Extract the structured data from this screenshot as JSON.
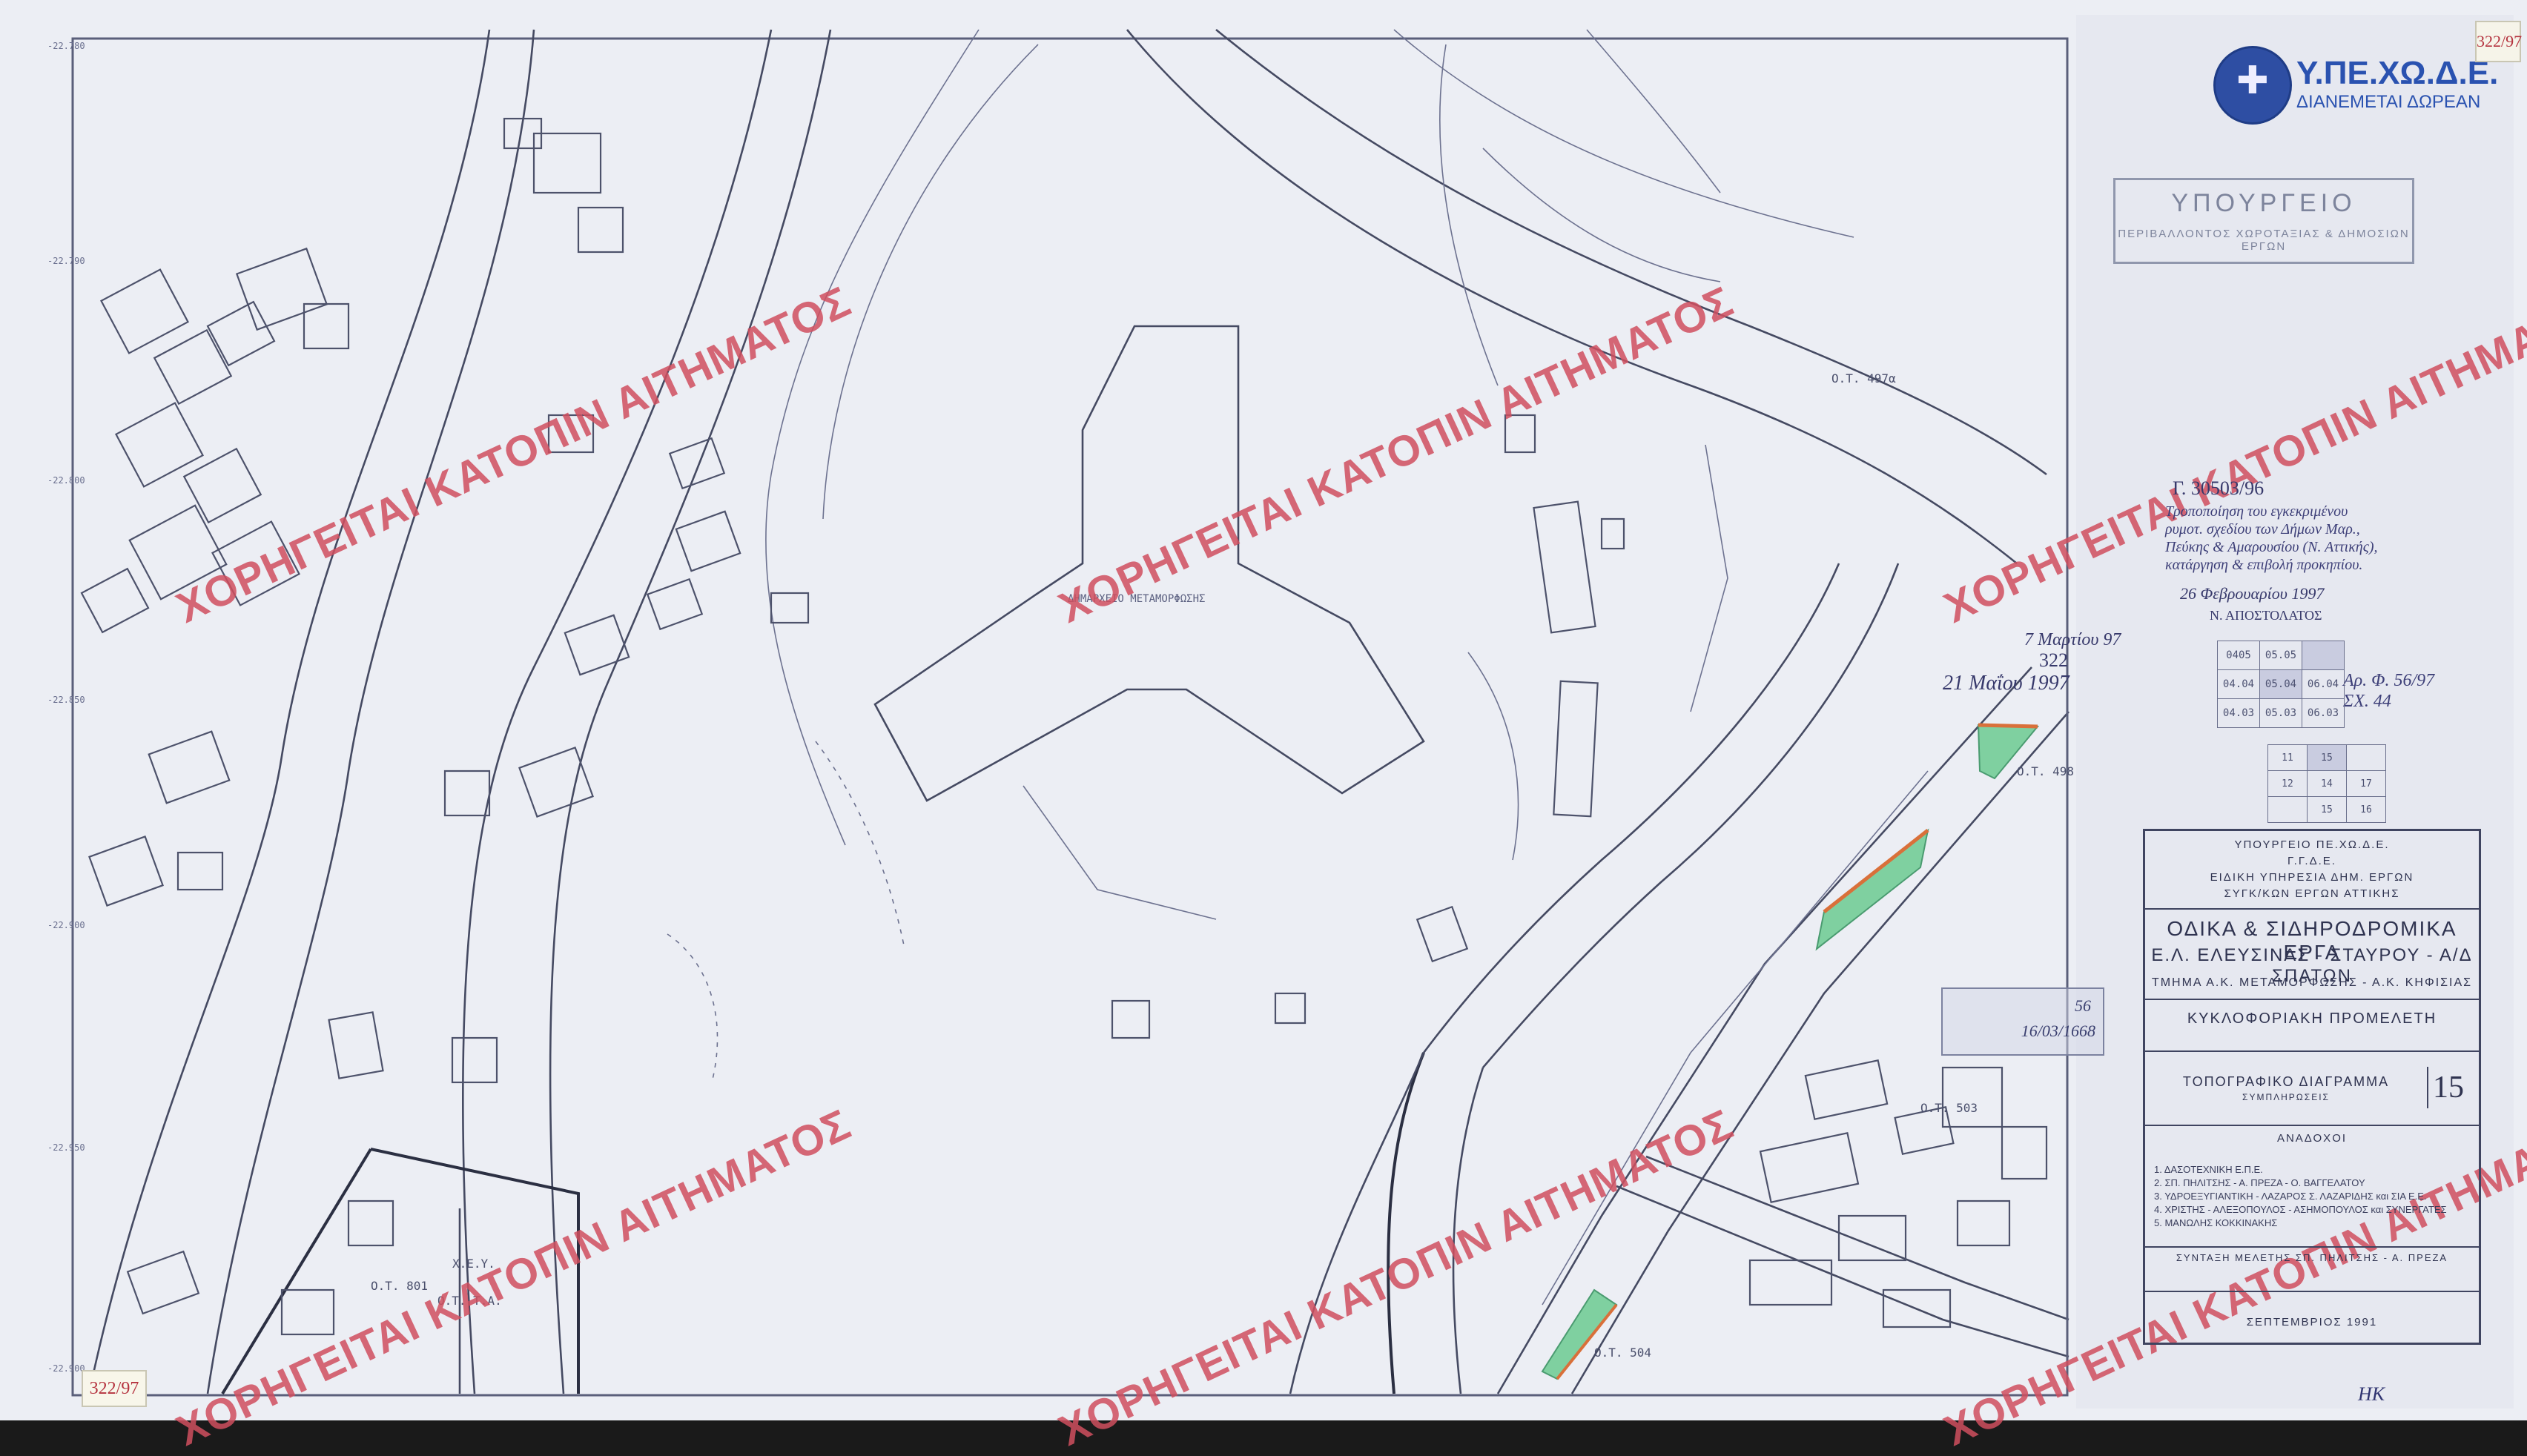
{
  "logo": {
    "brand": "Υ.ΠΕ.ΧΩ.Δ.Ε.",
    "subtitle": "ΔΙΑΝΕΜΕΤΑΙ ΔΩΡΕΑΝ",
    "color": "#2a52b0"
  },
  "folio": {
    "top_right": "322/97",
    "bottom_left": "322/97",
    "bottom_right": "ΗΚ"
  },
  "watermark": {
    "text": "ΧΟΡΗΓΕΙΤΑΙ ΚΑΤΟΠΙΝ ΑΙΤΗΜΑΤΟΣ",
    "color": "#d04f5f"
  },
  "ministry_stamp": {
    "line1": "ΥΠΟΥΡΓΕΙΟ",
    "line2": "ΠΕΡΙΒΑΛΛΟΝΤΟΣ ΧΩΡΟΤΑΞΙΑΣ & ΔΗΜΟΣΙΩΝ ΕΡΓΩΝ"
  },
  "approval": {
    "ref": "Γ. 30503/96",
    "note": "Τροποποίηση του εγκεκριμένου ρυμοτ. σχεδίου των Δήμων Μαρ., Πεύκης & Αμαρουσίου (Ν. Αττικής), κατάργηση & επιβολή προκηπίου.",
    "date": "26 Φεβρουαρίου 1997",
    "signer": "Ν. ΑΠΟΣΤΟΛΑΤΟΣ"
  },
  "registry": {
    "date1": "7 Μαρτίου 97",
    "number": "322",
    "date2": "21 Μαΐου 1997"
  },
  "handnote": {
    "text": "Αρ. Φ. 56/97 ΣΧ. 44"
  },
  "sheet_index": {
    "rows": [
      [
        "0405",
        "05.05",
        ""
      ],
      [
        "04.04",
        "05.04",
        "06.04"
      ],
      [
        "04.03",
        "05.03",
        "06.03"
      ]
    ]
  },
  "small_index": {
    "rows": [
      [
        "11",
        "15",
        ""
      ],
      [
        "12",
        "14",
        "17"
      ],
      [
        "",
        "15",
        "16"
      ]
    ]
  },
  "gray_stamp": {
    "num": "56",
    "date": "16/03/1668"
  },
  "title_block": {
    "ministry": "ΥΠΟΥΡΓΕΙΟ ΠΕ.ΧΩ.Δ.Ε.",
    "ggde": "Γ.Γ.Δ.Ε.",
    "service": "ΕΙΔΙΚΗ ΥΠΗΡΕΣΙΑ ΔΗΜ. ΕΡΓΩΝ",
    "service2": "ΣΥΓΚ/ΚΩΝ ΕΡΓΩΝ ΑΤΤΙΚΗΣ",
    "project1": "ΟΔΙΚΑ & ΣΙΔΗΡΟΔΡΟΜΙΚΑ ΕΡΓΑ",
    "project2": "Ε.Λ. ΕΛΕΥΣΙΝΑΣ - ΣΤΑΥΡΟΥ - Α/Δ ΣΠΑΤΩΝ",
    "section": "ΤΜΗΜΑ Α.Κ. ΜΕΤΑΜΟΡΦΩΣΗΣ - Α.Κ. ΚΗΦΙΣΙΑΣ",
    "study": "ΚΥΚΛΟΦΟΡΙΑΚΗ ΠΡΟΜΕΛΕΤΗ",
    "drawing": "ΤΟΠΟΓΡΑΦΙΚΟ ΔΙΑΓΡΑΜΜΑ",
    "drawing_sub": "ΣΥΜΠΛΗΡΩΣΕΙΣ",
    "sheet_no": "15",
    "contractors_title": "ΑΝΑΔΟΧΟΙ",
    "contractors": [
      "1. ΔΑΣΟΤΕΧΝΙΚΗ Ε.Π.Ε.",
      "2. ΣΠ. ΠΗΛΙΤΣΗΣ - Α. ΠΡΕΖΑ - Ο. ΒΑΓΓΕΛΑΤΟΥ",
      "3. ΥΔΡΟΕΞΥΓΙΑΝΤΙΚΗ - ΛΑΖΑΡΟΣ Σ. ΛΑΖΑΡΙΔΗΣ και ΣΙΑ Ε.Ε.",
      "4. ΧΡΙΣΤΗΣ - ΑΛΕΞΟΠΟΥΛΟΣ - ΑΣΗΜΟΠΟΥΛΟΣ και ΣΥΝΕΡΓΑΤΕΣ",
      "5. ΜΑΝΩΛΗΣ ΚΟΚΚΙΝΑΚΗΣ"
    ],
    "synthesis": "ΣΥΝΤΑΞΗ ΜΕΛΕΤΗΣ  ΣΠ. ΠΗΛΙΤΣΗΣ - Α. ΠΡΕΖΑ",
    "date": "ΣΕΠΤΕΜΒΡΙΟΣ 1991"
  },
  "map_labels": {
    "ot_497a": "Ο.Τ. 497α",
    "ot_498": "Ο.Τ. 498",
    "ot_503": "Ο.Τ. 503",
    "ot_504": "Ο.Τ. 504",
    "ot_801": "Ο.Τ. 801",
    "xey": "Χ.Ε.Υ.",
    "ot_ta": "Ο.Τ. Τ.Α.",
    "center": "ΔΗΜΑΡΧΕΙΟ ΜΕΤΑΜΟΡΦΩΣΗΣ"
  },
  "colors": {
    "paper": "#eceef4",
    "ink": "#4a4f66",
    "green_strip": "#7fd0a0",
    "orange_edge": "#d9703a"
  }
}
